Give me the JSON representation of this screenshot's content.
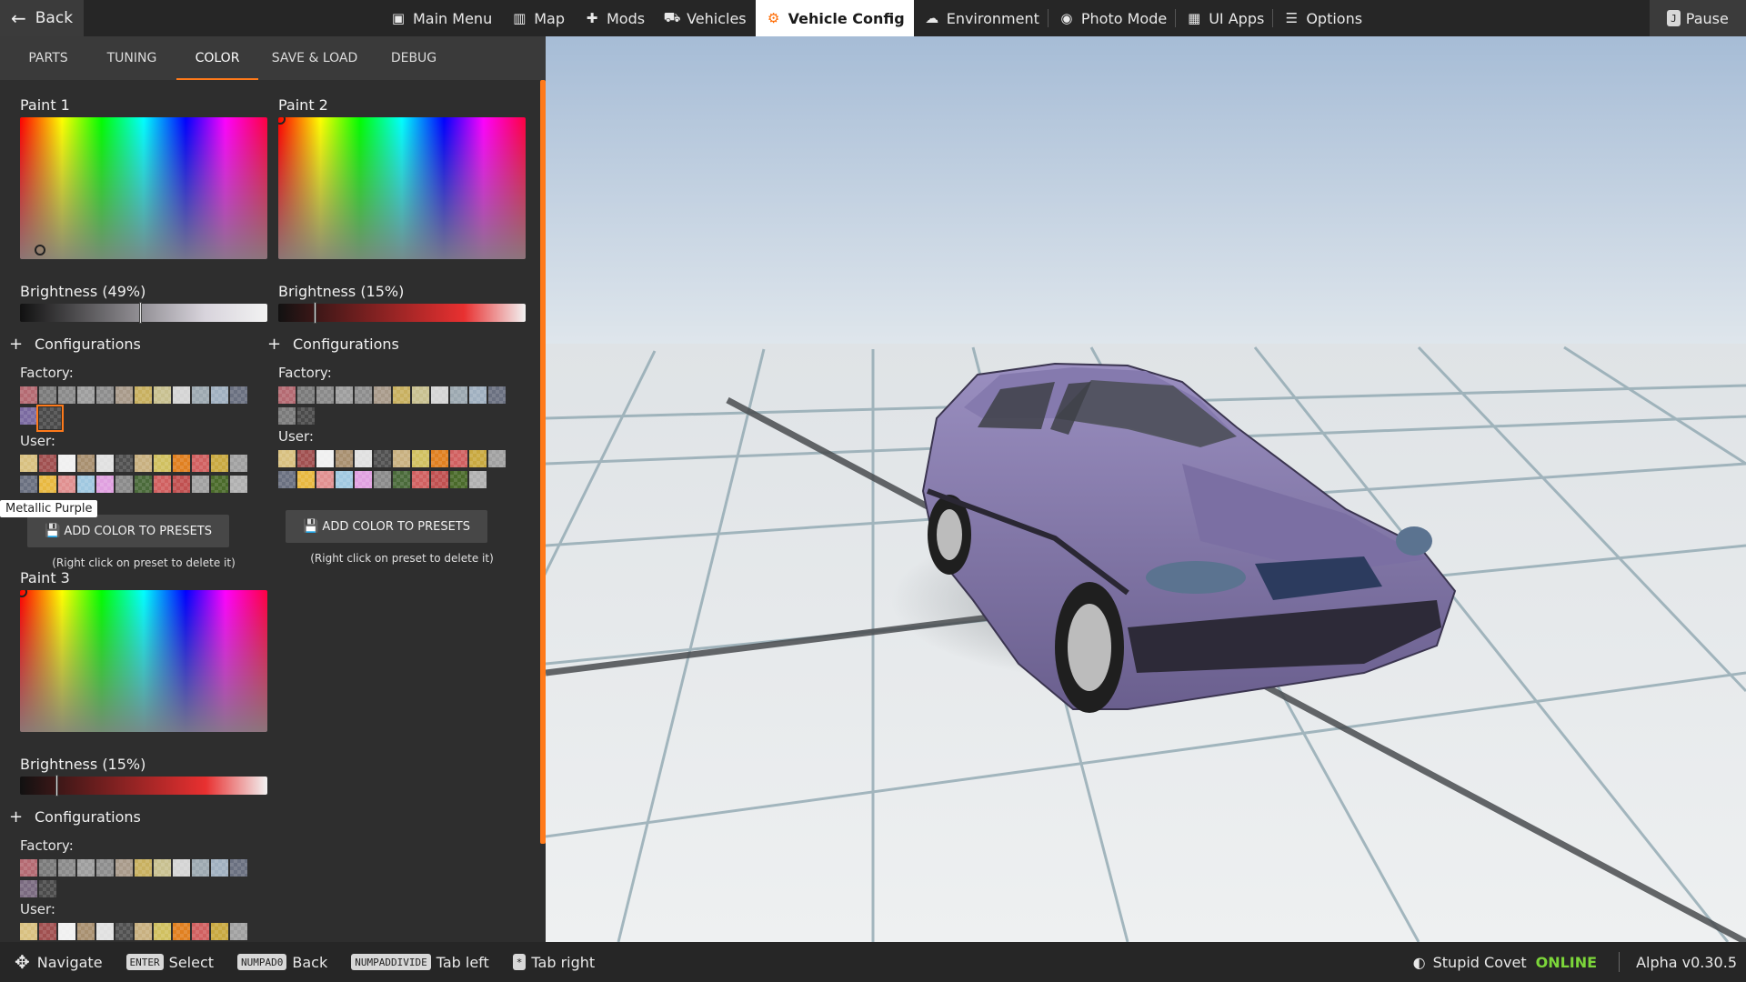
{
  "topbar": {
    "back_label": "Back",
    "nav": [
      {
        "label": "Main Menu",
        "icon": "main-menu-icon",
        "glyph": "▣"
      },
      {
        "label": "Map",
        "icon": "map-icon",
        "glyph": "▥"
      },
      {
        "label": "Mods",
        "icon": "puzzle-icon",
        "glyph": "✚"
      },
      {
        "label": "Vehicles",
        "icon": "car-icon",
        "glyph": "⛟"
      },
      {
        "label": "Vehicle Config",
        "icon": "engine-icon",
        "glyph": "⚙",
        "active": true
      },
      {
        "label": "Environment",
        "icon": "weather-icon",
        "glyph": "☁"
      },
      {
        "label": "Photo Mode",
        "icon": "camera-icon",
        "glyph": "◉"
      },
      {
        "label": "UI Apps",
        "icon": "apps-icon",
        "glyph": "▦"
      },
      {
        "label": "Options",
        "icon": "sliders-icon",
        "glyph": "☰"
      }
    ],
    "pause_label": "Pause",
    "pause_key": "J"
  },
  "tabs": [
    "PARTS",
    "TUNING",
    "COLOR",
    "SAVE & LOAD",
    "DEBUG"
  ],
  "active_tab": "COLOR",
  "paints": [
    {
      "title": "Paint 1",
      "brightness_label": "Brightness (49%)",
      "brightness": 0.49,
      "bar_color": "#d8d4dc",
      "configurations_label": "Configurations",
      "factory_label": "Factory:",
      "user_label": "User:",
      "factory": [
        "#b46a72",
        "#7a7a7a",
        "#8a8a8a",
        "#9d9d9d",
        "#8d8d8d",
        "#a89a8a",
        "#c8b060",
        "#c8c090",
        "#d4d4d4",
        "#9ca8b0",
        "#a0b0c0",
        "#6a7080",
        "#7a6aa0",
        "#4a4a4a"
      ],
      "user": [
        "#d8c080",
        "#a05050",
        "#f0f0f0",
        "#a89070",
        "#e0e0e0",
        "#505050",
        "#c8b080",
        "#d0c060",
        "#e08020",
        "#d06060",
        "#c8a840",
        "#a0a0a0",
        "#6a7080",
        "#e8b840",
        "#e09090",
        "#a0c8e0",
        "#e0a0e0",
        "#8a8a8a",
        "#4a6a3a",
        "#d06060",
        "#c05050",
        "#a0a0a0",
        "#4a6a2a",
        "#b0b0b0"
      ],
      "add_label": "ADD COLOR TO PRESETS",
      "hint": "(Right click on preset to delete it)",
      "tooltip": "Metallic Purple"
    },
    {
      "title": "Paint 2",
      "brightness_label": "Brightness (15%)",
      "brightness": 0.15,
      "bar_color": "#e83030",
      "configurations_label": "Configurations",
      "factory_label": "Factory:",
      "user_label": "User:",
      "factory": [
        "#b46a72",
        "#7a7a7a",
        "#8a8a8a",
        "#9d9d9d",
        "#8d8d8d",
        "#a89a8a",
        "#c8b060",
        "#c8c090",
        "#d4d4d4",
        "#9ca8b0",
        "#a0b0c0",
        "#6a7080",
        "#7a7a7a",
        "#4a4a4a"
      ],
      "user": [
        "#d8c080",
        "#a05050",
        "#f0f0f0",
        "#a89070",
        "#e0e0e0",
        "#505050",
        "#c8b080",
        "#d0c060",
        "#e08020",
        "#d06060",
        "#c8a840",
        "#a0a0a0",
        "#6a7080",
        "#e8b840",
        "#e09090",
        "#a0c8e0",
        "#e0a0e0",
        "#8a8a8a",
        "#4a6a3a",
        "#d06060",
        "#c05050",
        "#4a6a2a",
        "#b0b0b0"
      ],
      "add_label": "ADD COLOR TO PRESETS",
      "hint": "(Right click on preset to delete it)"
    },
    {
      "title": "Paint 3",
      "brightness_label": "Brightness (15%)",
      "brightness": 0.15,
      "bar_color": "#e83030",
      "configurations_label": "Configurations",
      "factory_label": "Factory:",
      "user_label": "User:",
      "factory": [
        "#b46a72",
        "#7a7a7a",
        "#8a8a8a",
        "#9d9d9d",
        "#8d8d8d",
        "#a89a8a",
        "#c8b060",
        "#c8c090",
        "#d4d4d4",
        "#9ca8b0",
        "#a0b0c0",
        "#6a7080",
        "#7a6a80",
        "#4a4a4a"
      ],
      "user": [
        "#d8c080",
        "#a05050",
        "#f0f0f0",
        "#a89070",
        "#e0e0e0",
        "#505050",
        "#c8b080",
        "#d0c060",
        "#e08020",
        "#d06060",
        "#c8a840",
        "#a0a0a0",
        "#6a7080",
        "#e8b840"
      ]
    }
  ],
  "bottombar": {
    "hints": [
      {
        "key": "✥",
        "label": "Navigate",
        "icon": "dpad-icon"
      },
      {
        "key": "ENTER",
        "label": "Select"
      },
      {
        "key": "NUMPAD0",
        "label": "Back"
      },
      {
        "key": "NUMPADDIVIDE",
        "label": "Tab left"
      },
      {
        "key": "*",
        "label": "Tab right"
      }
    ],
    "username": "Stupid Covet",
    "online": "ONLINE",
    "version": "Alpha v0.30.5"
  },
  "colors": {
    "accent": "#ff7a1a",
    "car_body": "#7b6fa0",
    "sky_top": "#a8bed8",
    "floor": "#e6e8ea"
  }
}
